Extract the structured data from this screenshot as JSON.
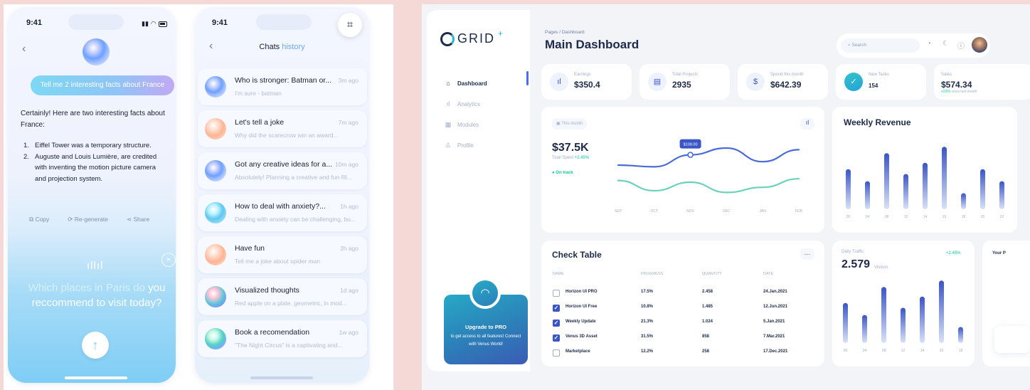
{
  "phone1": {
    "time": "9:41",
    "user_message": "Tell me 2 interesting facts about France",
    "ai_intro": "Certainly! Here are two interesting facts about France:",
    "ai_facts": [
      "Eiffel Tower was a temporary structure.",
      "Auguste and Louis Lumière, are credited with inventing the motion picture camera and projection system."
    ],
    "actions": {
      "copy": "Copy",
      "regenerate": "Re-generate",
      "share": "Share"
    },
    "voice_question_faded": "Which places in Paris do",
    "voice_question": "you reccommend to visit today?"
  },
  "phone2": {
    "time": "9:41",
    "title_main": "Chats",
    "title_accent": "history",
    "chats": [
      {
        "title": "Who is stronger: Batman or...",
        "preview": "I'm sure - batman",
        "time": "3m ago",
        "orb": "orb-blue"
      },
      {
        "title": "Let's tell a joke",
        "preview": "Why did the scarecrow win an award...",
        "time": "7m ago",
        "orb": "orb-peach"
      },
      {
        "title": "Got any creative ideas for a...",
        "preview": "Absolutely! Planning a creative and fun-fill...",
        "time": "10m ago",
        "orb": "orb-blue"
      },
      {
        "title": "How to deal with anxiety?...",
        "preview": "Dealing with anxiety can be challenging, bu...",
        "time": "1h ago",
        "orb": "orb-cyan"
      },
      {
        "title": "Have fun",
        "preview": "Tell me a joke about spider man",
        "time": "2h ago",
        "orb": "orb-peach"
      },
      {
        "title": "Visualized thoughts",
        "preview": "Red apple on a plate, geometric, in mod...",
        "time": "1d ago",
        "orb": "orb-multi"
      },
      {
        "title": "Book a recomendation",
        "preview": "\"The Night Circus\" is a captivating and...",
        "time": "1w ago",
        "orb": "orb-green"
      }
    ]
  },
  "dashboard": {
    "logo": "GRID",
    "breadcrumb": "Pages / Dashboard",
    "page_title": "Main Dashboard",
    "search_placeholder": "Search",
    "nav": [
      {
        "label": "Dashboard",
        "icon": "home-icon",
        "active": true
      },
      {
        "label": "Analytics",
        "icon": "bar-chart-icon",
        "active": false
      },
      {
        "label": "Modules",
        "icon": "grid-icon",
        "active": false
      },
      {
        "label": "Profile",
        "icon": "user-icon",
        "active": false
      }
    ],
    "upgrade": {
      "title": "Upgrade to PRO",
      "subtitle": "to get access to all features! Connect with Venus World!"
    },
    "stats": [
      {
        "label": "Earnings",
        "value": "$350.4",
        "icon": "bar-chart-icon"
      },
      {
        "label": "Total Projects",
        "value": "2935",
        "icon": "document-icon"
      },
      {
        "label": "Spend this month",
        "value": "$642.39",
        "icon": "dollar-icon"
      },
      {
        "label": "New Tasks",
        "value": "154",
        "icon": "check-icon"
      },
      {
        "label": "Sales",
        "value": "$574.34",
        "note_up": "+23%",
        "note": "since last month"
      }
    ],
    "line_card": {
      "range": "This month",
      "value": "$37.5K",
      "label": "Total Spent",
      "change": "+2.45%",
      "status": "On track",
      "tooltip": "$108.00",
      "months": [
        "SEP",
        "OCT",
        "NOV",
        "DEC",
        "JAN",
        "FEB"
      ]
    },
    "weekly_revenue": {
      "title": "Weekly Revenue",
      "labels": [
        "00",
        "04",
        "08",
        "12",
        "14",
        "16",
        "18",
        "20",
        "22"
      ]
    },
    "check_table": {
      "title": "Check Table",
      "headers": [
        "NAME",
        "PROGRESS",
        "QUANTITY",
        "DATE"
      ],
      "rows": [
        {
          "checked": false,
          "name": "Horizon UI PRO",
          "progress": "17.5%",
          "quantity": "2.458",
          "date": "24.Jan.2021"
        },
        {
          "checked": true,
          "name": "Horizon UI Free",
          "progress": "10.8%",
          "quantity": "1.485",
          "date": "12.Jun.2021"
        },
        {
          "checked": true,
          "name": "Weekly Update",
          "progress": "21.3%",
          "quantity": "1.024",
          "date": "5.Jan.2021"
        },
        {
          "checked": true,
          "name": "Venus 3D Asset",
          "progress": "31.5%",
          "quantity": "858",
          "date": "7.Mar.2021"
        },
        {
          "checked": false,
          "name": "Marketplace",
          "progress": "12.2%",
          "quantity": "258",
          "date": "17.Dec.2021"
        }
      ]
    },
    "daily_traffic": {
      "title": "Daily Traffic",
      "value": "2.579",
      "unit": "Visitors",
      "change": "+2.45%",
      "labels": [
        "00",
        "04",
        "08",
        "12",
        "14",
        "16",
        "18"
      ]
    },
    "your_pie": {
      "title": "Your P"
    }
  },
  "chart_data": [
    {
      "type": "line",
      "categories": [
        "SEP",
        "OCT",
        "NOV",
        "DEC",
        "JAN",
        "FEB"
      ],
      "series": [
        {
          "values": [
            40,
            38,
            52,
            60,
            44,
            58
          ]
        },
        {
          "values": [
            22,
            10,
            20,
            8,
            14,
            24
          ]
        }
      ],
      "tooltip": "$108.00"
    },
    {
      "type": "bar",
      "title": "Weekly Revenue",
      "categories": [
        "00",
        "04",
        "08",
        "12",
        "14",
        "16",
        "18",
        "20",
        "22"
      ],
      "values": [
        50,
        35,
        70,
        44,
        58,
        78,
        20,
        50,
        35
      ]
    },
    {
      "type": "bar",
      "title": "Daily Traffic",
      "categories": [
        "00",
        "04",
        "08",
        "12",
        "14",
        "16",
        "18"
      ],
      "values": [
        50,
        35,
        70,
        44,
        58,
        78,
        20
      ]
    }
  ]
}
